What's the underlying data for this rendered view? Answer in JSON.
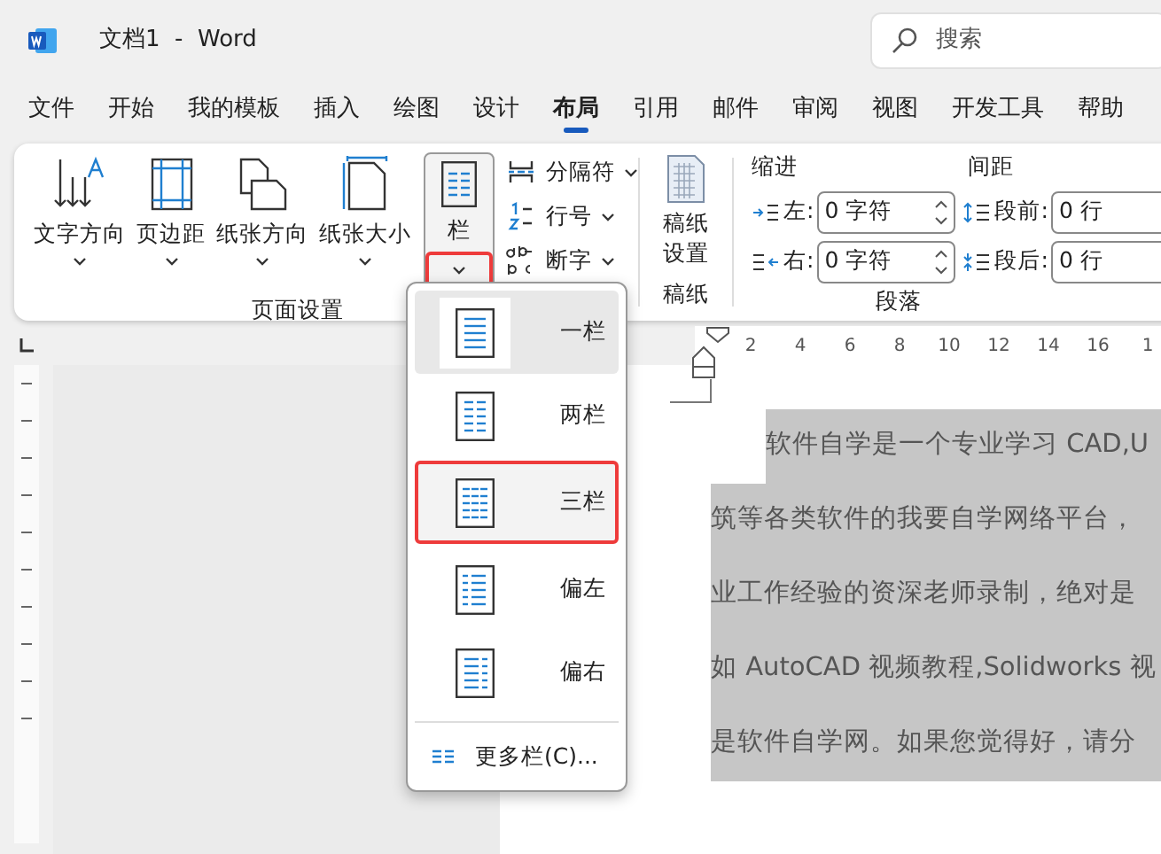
{
  "window": {
    "title": "文档1  -  Word"
  },
  "search": {
    "placeholder": "搜索"
  },
  "tabs": [
    {
      "label": "文件",
      "selected": false
    },
    {
      "label": "开始",
      "selected": false
    },
    {
      "label": "我的模板",
      "selected": false
    },
    {
      "label": "插入",
      "selected": false
    },
    {
      "label": "绘图",
      "selected": false
    },
    {
      "label": "设计",
      "selected": false
    },
    {
      "label": "布局",
      "selected": true
    },
    {
      "label": "引用",
      "selected": false
    },
    {
      "label": "邮件",
      "selected": false
    },
    {
      "label": "审阅",
      "selected": false
    },
    {
      "label": "视图",
      "selected": false
    },
    {
      "label": "开发工具",
      "selected": false
    },
    {
      "label": "帮助",
      "selected": false
    }
  ],
  "page_setup": {
    "big_buttons": [
      {
        "label": "文字方向",
        "kind": "text-direction"
      },
      {
        "label": "页边距",
        "kind": "margins"
      },
      {
        "label": "纸张方向",
        "kind": "orientation"
      },
      {
        "label": "纸张大小",
        "kind": "size"
      }
    ],
    "columns_button": {
      "label": "栏",
      "outlined": true
    },
    "small_buttons": [
      {
        "label": "分隔符",
        "kind": "breaks"
      },
      {
        "label": "行号",
        "kind": "line-numbers"
      },
      {
        "label": "断字",
        "kind": "hyphenation"
      }
    ],
    "label": "页面设置"
  },
  "draft": {
    "button": "稿纸设置",
    "label": "稿纸"
  },
  "paragraph": {
    "indent_title": "缩进",
    "spacing_title": "间距",
    "label": "段落",
    "fields": [
      {
        "label": "左:",
        "value": "0 字符",
        "kind": "indent-left"
      },
      {
        "label": "段前:",
        "value": "0 行",
        "kind": "space-before"
      },
      {
        "label": "右:",
        "value": "0 字符",
        "kind": "indent-right"
      },
      {
        "label": "段后:",
        "value": "0 行",
        "kind": "space-after"
      }
    ]
  },
  "columns_menu": {
    "items": [
      {
        "label": "一栏",
        "kind": "one",
        "selected": true,
        "outlined": false
      },
      {
        "label": "两栏",
        "kind": "two",
        "selected": false,
        "outlined": false
      },
      {
        "label": "三栏",
        "kind": "three",
        "selected": false,
        "outlined": true
      },
      {
        "label": "偏左",
        "kind": "left",
        "selected": false,
        "outlined": false
      },
      {
        "label": "偏右",
        "kind": "right",
        "selected": false,
        "outlined": false
      }
    ],
    "more": "更多栏(C)..."
  },
  "ruler": {
    "ticks": [
      "2",
      "4",
      "6",
      "8",
      "10",
      "12",
      "14",
      "16",
      "1"
    ]
  },
  "document": {
    "highlighted": true,
    "lines": [
      "软件自学是一个专业学习 CAD,U",
      "筑等各类软件的我要自学网络平台，",
      "业工作经验的资深老师录制，绝对是",
      "如 AutoCAD 视频教程,Solidworks 视",
      "是软件自学网。如果您觉得好，请分"
    ]
  }
}
